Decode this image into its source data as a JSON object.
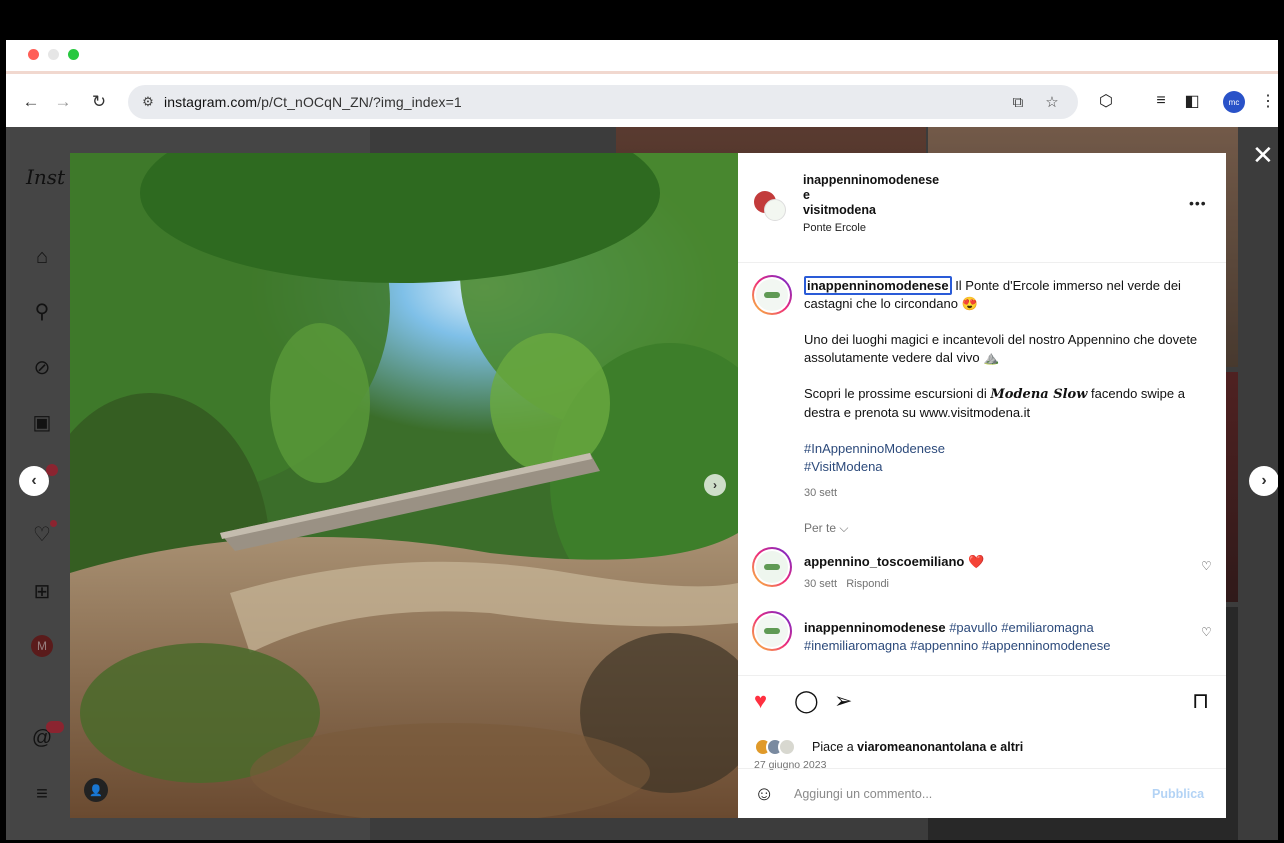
{
  "browser": {
    "url_host": "instagram.com",
    "url_path": "/p/Ct_nOCqN_ZN/?img_index=1",
    "profile_initials": "mc"
  },
  "instagram": {
    "logo_text": "Inst"
  },
  "post": {
    "header": {
      "user1": "inappenninomodenese",
      "conjunction": "e",
      "user2": "visitmodena",
      "location": "Ponte Ercole"
    },
    "caption": {
      "user": "inappenninomodenese",
      "para1": " Il Ponte d'Ercole immerso nel verde dei castagni che lo circondano 😍",
      "para2": "Uno dei luoghi magici e incantevoli del nostro Appennino che dovete assolutamente vedere dal vivo ⛰️",
      "para3_a": "Scopri le prossime escursioni di ",
      "para3_brand": "Modena Slow",
      "para3_b": " facendo swipe a destra e prenota su www.visitmodena.it",
      "hashtag1": "#InAppenninoModenese",
      "hashtag2": "#VisitModena",
      "date": "30 sett"
    },
    "per_te": "Per te ⌵",
    "comments": [
      {
        "user": "appennino_toscoemiliano",
        "text": " ❤️",
        "date": "30 sett",
        "reply": "Rispondi"
      },
      {
        "user": "inappenninomodenese",
        "text": " #pavullo #emiliaromagna #inemiliaromagna #appennino #appenninomodenese"
      }
    ],
    "likes_prefix": "Piace a ",
    "likes_user": "viaromeanonantolana",
    "likes_suffix": " e altri",
    "post_date": "27 giugno 2023",
    "comment_placeholder": "Aggiungi un commento...",
    "publish_label": "Pubblica"
  },
  "colors": {
    "like_red": "#ff3040",
    "hashtag_blue": "#2c4a7b",
    "publish_disabled": "#b3d3f5"
  }
}
